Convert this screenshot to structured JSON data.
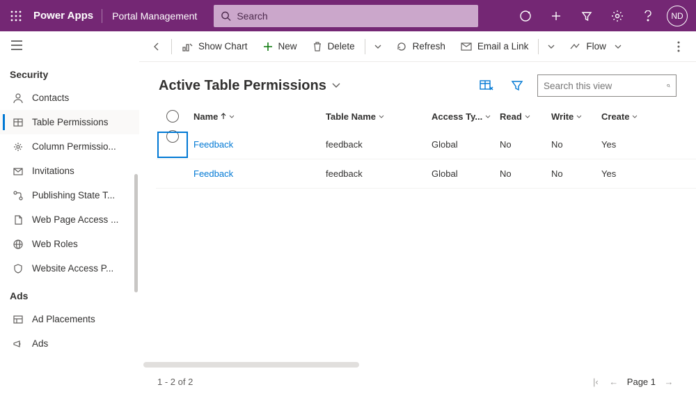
{
  "topbar": {
    "brand": "Power Apps",
    "app": "Portal Management",
    "search_placeholder": "Search",
    "avatar_initials": "ND"
  },
  "sidebar": {
    "sections": [
      {
        "title": "Security",
        "items": [
          {
            "label": "Contacts",
            "active": false,
            "name": "sidebar-item-contacts",
            "icon": "person"
          },
          {
            "label": "Table Permissions",
            "active": true,
            "name": "sidebar-item-table-permissions",
            "icon": "table"
          },
          {
            "label": "Column Permissio...",
            "active": false,
            "name": "sidebar-item-column-permissions",
            "icon": "column"
          },
          {
            "label": "Invitations",
            "active": false,
            "name": "sidebar-item-invitations",
            "icon": "mail"
          },
          {
            "label": "Publishing State T...",
            "active": false,
            "name": "sidebar-item-publishing-state",
            "icon": "flow"
          },
          {
            "label": "Web Page Access ...",
            "active": false,
            "name": "sidebar-item-web-page-access",
            "icon": "page"
          },
          {
            "label": "Web Roles",
            "active": false,
            "name": "sidebar-item-web-roles",
            "icon": "globe"
          },
          {
            "label": "Website Access P...",
            "active": false,
            "name": "sidebar-item-website-access",
            "icon": "shield"
          }
        ]
      },
      {
        "title": "Ads",
        "items": [
          {
            "label": "Ad Placements",
            "active": false,
            "name": "sidebar-item-ad-placements",
            "icon": "layout"
          },
          {
            "label": "Ads",
            "active": false,
            "name": "sidebar-item-ads",
            "icon": "megaphone"
          }
        ]
      }
    ]
  },
  "commandbar": {
    "show_chart": "Show Chart",
    "new": "New",
    "delete": "Delete",
    "refresh": "Refresh",
    "email_link": "Email a Link",
    "flow": "Flow"
  },
  "view": {
    "title": "Active Table Permissions",
    "search_placeholder": "Search this view"
  },
  "grid": {
    "columns": {
      "name": "Name",
      "table_name": "Table Name",
      "access_type": "Access Ty...",
      "read": "Read",
      "write": "Write",
      "create": "Create"
    },
    "rows": [
      {
        "name": "Feedback",
        "table_name": "feedback",
        "access_type": "Global",
        "read": "No",
        "write": "No",
        "create": "Yes",
        "selected": true
      },
      {
        "name": "Feedback",
        "table_name": "feedback",
        "access_type": "Global",
        "read": "No",
        "write": "No",
        "create": "Yes",
        "selected": false
      }
    ]
  },
  "pager": {
    "range": "1 - 2 of 2",
    "page_label": "Page 1"
  }
}
